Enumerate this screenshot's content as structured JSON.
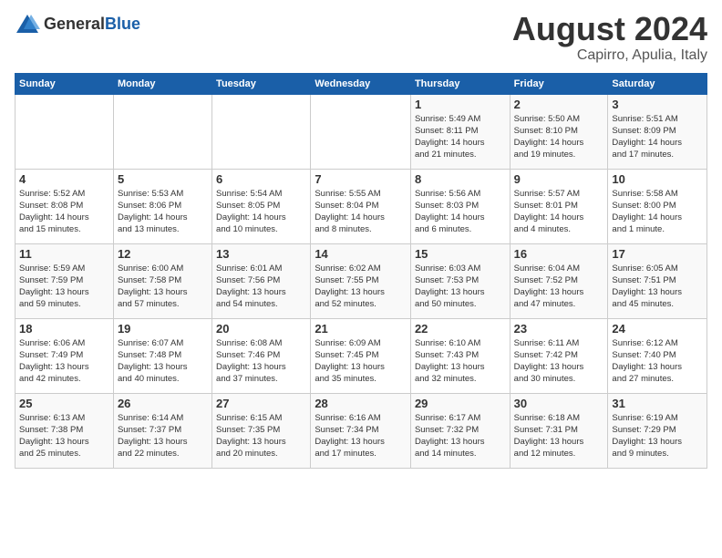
{
  "logo": {
    "general": "General",
    "blue": "Blue"
  },
  "title": "August 2024",
  "location": "Capirro, Apulia, Italy",
  "days_of_week": [
    "Sunday",
    "Monday",
    "Tuesday",
    "Wednesday",
    "Thursday",
    "Friday",
    "Saturday"
  ],
  "weeks": [
    [
      {
        "day": "",
        "info": ""
      },
      {
        "day": "",
        "info": ""
      },
      {
        "day": "",
        "info": ""
      },
      {
        "day": "",
        "info": ""
      },
      {
        "day": "1",
        "info": "Sunrise: 5:49 AM\nSunset: 8:11 PM\nDaylight: 14 hours\nand 21 minutes."
      },
      {
        "day": "2",
        "info": "Sunrise: 5:50 AM\nSunset: 8:10 PM\nDaylight: 14 hours\nand 19 minutes."
      },
      {
        "day": "3",
        "info": "Sunrise: 5:51 AM\nSunset: 8:09 PM\nDaylight: 14 hours\nand 17 minutes."
      }
    ],
    [
      {
        "day": "4",
        "info": "Sunrise: 5:52 AM\nSunset: 8:08 PM\nDaylight: 14 hours\nand 15 minutes."
      },
      {
        "day": "5",
        "info": "Sunrise: 5:53 AM\nSunset: 8:06 PM\nDaylight: 14 hours\nand 13 minutes."
      },
      {
        "day": "6",
        "info": "Sunrise: 5:54 AM\nSunset: 8:05 PM\nDaylight: 14 hours\nand 10 minutes."
      },
      {
        "day": "7",
        "info": "Sunrise: 5:55 AM\nSunset: 8:04 PM\nDaylight: 14 hours\nand 8 minutes."
      },
      {
        "day": "8",
        "info": "Sunrise: 5:56 AM\nSunset: 8:03 PM\nDaylight: 14 hours\nand 6 minutes."
      },
      {
        "day": "9",
        "info": "Sunrise: 5:57 AM\nSunset: 8:01 PM\nDaylight: 14 hours\nand 4 minutes."
      },
      {
        "day": "10",
        "info": "Sunrise: 5:58 AM\nSunset: 8:00 PM\nDaylight: 14 hours\nand 1 minute."
      }
    ],
    [
      {
        "day": "11",
        "info": "Sunrise: 5:59 AM\nSunset: 7:59 PM\nDaylight: 13 hours\nand 59 minutes."
      },
      {
        "day": "12",
        "info": "Sunrise: 6:00 AM\nSunset: 7:58 PM\nDaylight: 13 hours\nand 57 minutes."
      },
      {
        "day": "13",
        "info": "Sunrise: 6:01 AM\nSunset: 7:56 PM\nDaylight: 13 hours\nand 54 minutes."
      },
      {
        "day": "14",
        "info": "Sunrise: 6:02 AM\nSunset: 7:55 PM\nDaylight: 13 hours\nand 52 minutes."
      },
      {
        "day": "15",
        "info": "Sunrise: 6:03 AM\nSunset: 7:53 PM\nDaylight: 13 hours\nand 50 minutes."
      },
      {
        "day": "16",
        "info": "Sunrise: 6:04 AM\nSunset: 7:52 PM\nDaylight: 13 hours\nand 47 minutes."
      },
      {
        "day": "17",
        "info": "Sunrise: 6:05 AM\nSunset: 7:51 PM\nDaylight: 13 hours\nand 45 minutes."
      }
    ],
    [
      {
        "day": "18",
        "info": "Sunrise: 6:06 AM\nSunset: 7:49 PM\nDaylight: 13 hours\nand 42 minutes."
      },
      {
        "day": "19",
        "info": "Sunrise: 6:07 AM\nSunset: 7:48 PM\nDaylight: 13 hours\nand 40 minutes."
      },
      {
        "day": "20",
        "info": "Sunrise: 6:08 AM\nSunset: 7:46 PM\nDaylight: 13 hours\nand 37 minutes."
      },
      {
        "day": "21",
        "info": "Sunrise: 6:09 AM\nSunset: 7:45 PM\nDaylight: 13 hours\nand 35 minutes."
      },
      {
        "day": "22",
        "info": "Sunrise: 6:10 AM\nSunset: 7:43 PM\nDaylight: 13 hours\nand 32 minutes."
      },
      {
        "day": "23",
        "info": "Sunrise: 6:11 AM\nSunset: 7:42 PM\nDaylight: 13 hours\nand 30 minutes."
      },
      {
        "day": "24",
        "info": "Sunrise: 6:12 AM\nSunset: 7:40 PM\nDaylight: 13 hours\nand 27 minutes."
      }
    ],
    [
      {
        "day": "25",
        "info": "Sunrise: 6:13 AM\nSunset: 7:38 PM\nDaylight: 13 hours\nand 25 minutes."
      },
      {
        "day": "26",
        "info": "Sunrise: 6:14 AM\nSunset: 7:37 PM\nDaylight: 13 hours\nand 22 minutes."
      },
      {
        "day": "27",
        "info": "Sunrise: 6:15 AM\nSunset: 7:35 PM\nDaylight: 13 hours\nand 20 minutes."
      },
      {
        "day": "28",
        "info": "Sunrise: 6:16 AM\nSunset: 7:34 PM\nDaylight: 13 hours\nand 17 minutes."
      },
      {
        "day": "29",
        "info": "Sunrise: 6:17 AM\nSunset: 7:32 PM\nDaylight: 13 hours\nand 14 minutes."
      },
      {
        "day": "30",
        "info": "Sunrise: 6:18 AM\nSunset: 7:31 PM\nDaylight: 13 hours\nand 12 minutes."
      },
      {
        "day": "31",
        "info": "Sunrise: 6:19 AM\nSunset: 7:29 PM\nDaylight: 13 hours\nand 9 minutes."
      }
    ]
  ]
}
